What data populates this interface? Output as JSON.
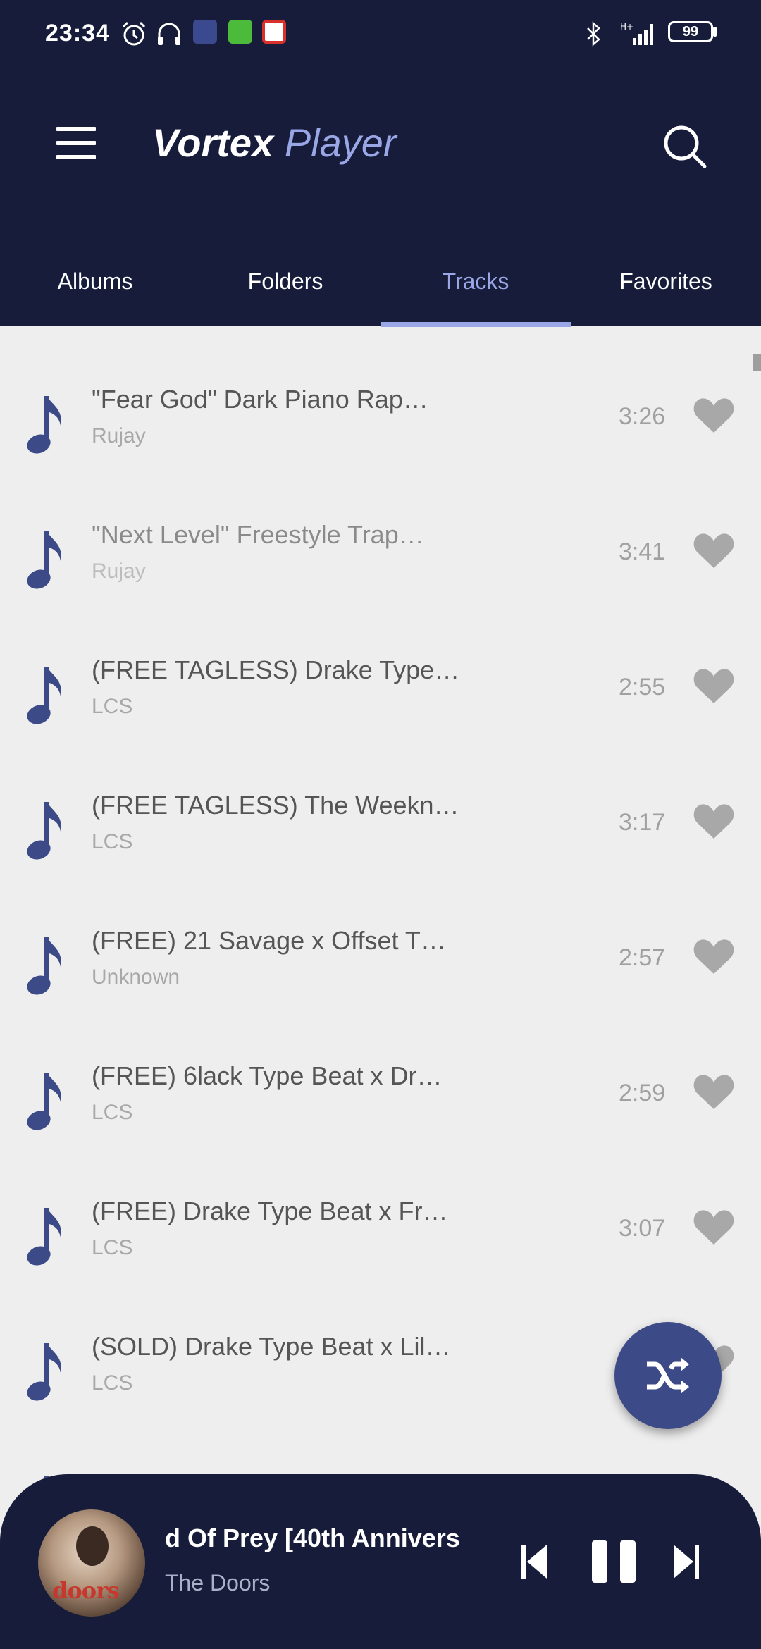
{
  "status_bar": {
    "time": "23:34",
    "battery": "99",
    "icons": [
      "alarm-icon",
      "headphones-icon",
      "soundwave-app-icon",
      "android-app-icon",
      "no-ads-icon",
      "bluetooth-icon",
      "signal-icon",
      "battery-icon"
    ]
  },
  "app_bar": {
    "title_bold": "Vortex",
    "title_light": "Player",
    "menu_icon": "menu-icon",
    "search_icon": "search-icon"
  },
  "tabs": [
    {
      "label": "Albums",
      "active": false
    },
    {
      "label": "Folders",
      "active": false
    },
    {
      "label": "Tracks",
      "active": true
    },
    {
      "label": "Favorites",
      "active": false
    }
  ],
  "tracks": [
    {
      "title": "\"Fear God\"   Dark Piano Rap…",
      "artist": "Rujay",
      "duration": "3:26"
    },
    {
      "title": "\"Next Level\"   Freestyle Trap…",
      "artist": "Rujay",
      "duration": "3:41"
    },
    {
      "title": "(FREE TAGLESS) Drake Type…",
      "artist": "LCS",
      "duration": "2:55"
    },
    {
      "title": "(FREE TAGLESS) The Weekn…",
      "artist": "LCS",
      "duration": "3:17"
    },
    {
      "title": "(FREE) 21 Savage x Offset T…",
      "artist": "Unknown",
      "duration": "2:57"
    },
    {
      "title": "(FREE) 6lack Type Beat x Dr…",
      "artist": "LCS",
      "duration": "2:59"
    },
    {
      "title": "(FREE) Drake Type Beat x Fr…",
      "artist": "LCS",
      "duration": "3:07"
    },
    {
      "title": "(SOLD) Drake Type Beat x Lil…",
      "artist": "LCS",
      "duration": ""
    }
  ],
  "fab": {
    "icon": "shuffle-icon"
  },
  "now_playing": {
    "title": "d Of Prey [40th Annivers",
    "artist": "The Doors",
    "album_art_text": "doors"
  },
  "colors": {
    "header_bg": "#161c3a",
    "accent": "#9aa7e6",
    "icon_blue": "#3c4a88",
    "list_bg": "#eeeeee"
  }
}
